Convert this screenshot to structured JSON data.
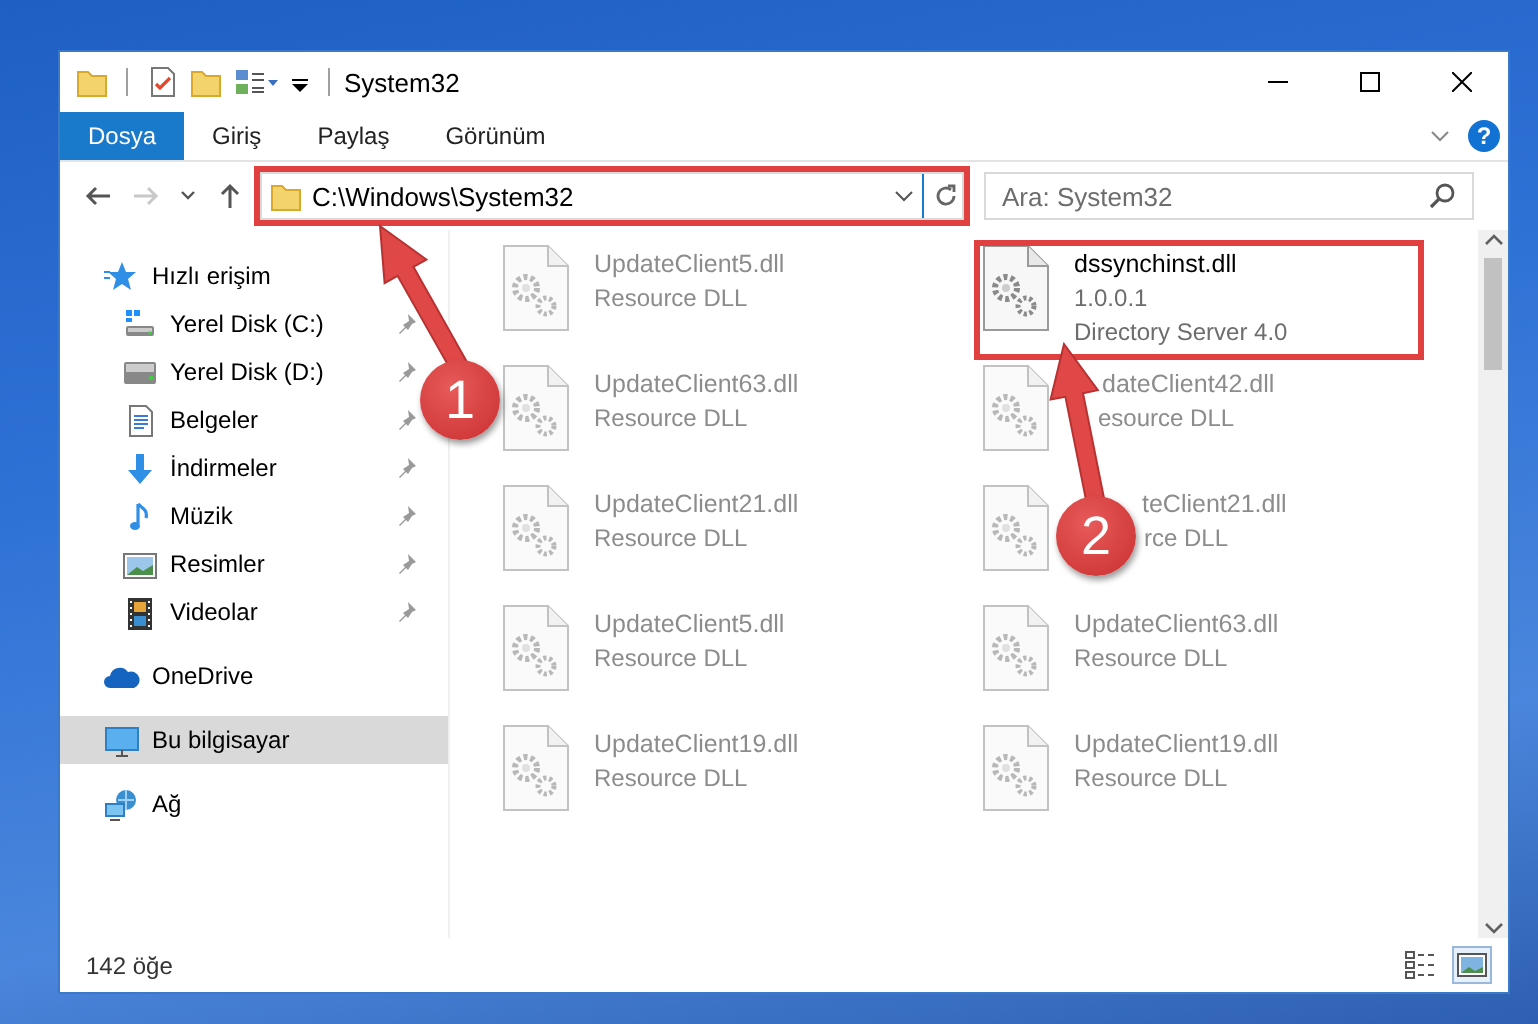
{
  "window": {
    "title": "System32"
  },
  "ribbon": {
    "tabs": [
      {
        "label": "Dosya",
        "selected": true
      },
      {
        "label": "Giriş",
        "selected": false
      },
      {
        "label": "Paylaş",
        "selected": false
      },
      {
        "label": "Görünüm",
        "selected": false
      }
    ],
    "help": "?"
  },
  "nav_buttons": [
    {
      "kind": "back",
      "disabled": false
    },
    {
      "kind": "forward",
      "disabled": true
    },
    {
      "kind": "recent",
      "disabled": false
    },
    {
      "kind": "up",
      "disabled": false
    }
  ],
  "address_bar": {
    "value": "C:\\Windows\\System32",
    "highlighted": true
  },
  "search": {
    "placeholder": "Ara: System32"
  },
  "sidebar": {
    "items": [
      {
        "label": "Hızlı erişim",
        "kind": "quick-access",
        "selected": false,
        "children": [
          {
            "label": "Yerel Disk (C:)",
            "kind": "system-drive",
            "pinned": true,
            "selected": false
          },
          {
            "label": "Yerel Disk (D:)",
            "kind": "drive",
            "pinned": true,
            "selected": false
          },
          {
            "label": "Belgeler",
            "kind": "documents",
            "pinned": true,
            "selected": false
          },
          {
            "label": "İndirmeler",
            "kind": "downloads",
            "pinned": true,
            "selected": false
          },
          {
            "label": "Müzik",
            "kind": "music",
            "pinned": true,
            "selected": false
          },
          {
            "label": "Resimler",
            "kind": "pictures",
            "pinned": true,
            "selected": false
          },
          {
            "label": "Videolar",
            "kind": "videos",
            "pinned": true,
            "selected": false
          }
        ]
      },
      {
        "label": "OneDrive",
        "kind": "cloud",
        "selected": false
      },
      {
        "label": "Bu bilgisayar",
        "kind": "computer",
        "selected": true
      },
      {
        "label": "Ağ",
        "kind": "network",
        "selected": false
      }
    ]
  },
  "files": [
    {
      "name": "UpdateClient5.dll",
      "details": [
        "Resource DLL"
      ],
      "blurred": true,
      "highlighted": false
    },
    {
      "name": "dssynchinst.dll",
      "details": [
        "1.0.0.1",
        "Directory Server 4.0"
      ],
      "blurred": false,
      "highlighted": true
    },
    {
      "name": "UpdateClient63.dll",
      "details": [
        "Resource DLL"
      ],
      "blurred": true,
      "highlighted": false
    },
    {
      "name": "dateClient42.dll",
      "details": [
        "esource DLL"
      ],
      "blurred": true,
      "highlighted": false
    },
    {
      "name": "UpdateClient21.dll",
      "details": [
        "Resource DLL"
      ],
      "blurred": true,
      "highlighted": false
    },
    {
      "name": "teClient21.dll",
      "details": [
        "rce DLL"
      ],
      "blurred": true,
      "highlighted": false
    },
    {
      "name": "UpdateClient5.dll",
      "details": [
        "Resource DLL"
      ],
      "blurred": true,
      "highlighted": false
    },
    {
      "name": "UpdateClient63.dll",
      "details": [
        "Resource DLL"
      ],
      "blurred": true,
      "highlighted": false
    },
    {
      "name": "UpdateClient19.dll",
      "details": [
        "Resource DLL"
      ],
      "blurred": true,
      "highlighted": false
    },
    {
      "name": "UpdateClient19.dll",
      "details": [
        "Resource DLL"
      ],
      "blurred": true,
      "highlighted": false
    }
  ],
  "status_bar": {
    "item_count": "142 öğe",
    "views": [
      {
        "kind": "details",
        "selected": false
      },
      {
        "kind": "large-icons",
        "selected": true
      }
    ]
  },
  "annotations": [
    {
      "number": "1"
    },
    {
      "number": "2"
    }
  ]
}
